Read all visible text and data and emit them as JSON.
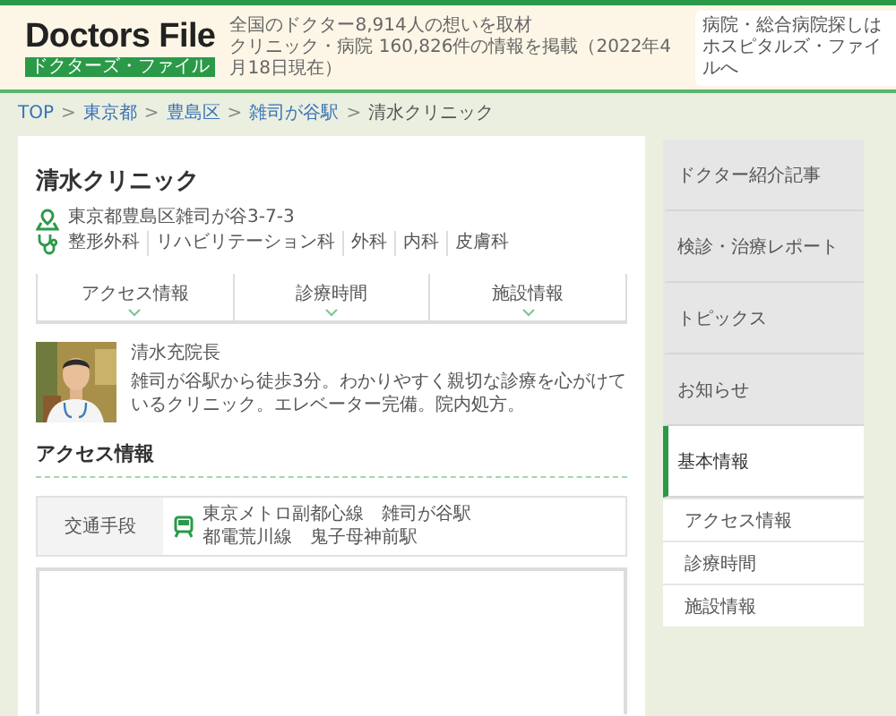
{
  "header": {
    "logo": "Doctors File",
    "logo_sub": "ドクターズ・ファイル",
    "tagline": [
      "全国のドクター8,914人の想いを取材",
      "クリニック・病院 160,826件の情報を掲載（2022年4月18日現在）"
    ],
    "hospital_link": [
      "病院・総合病院探しは",
      "ホスピタルズ・ファイルへ"
    ]
  },
  "breadcrumb": [
    {
      "label": "TOP",
      "separator": ">"
    },
    {
      "label": "東京都",
      "separator": ">"
    },
    {
      "label": "豊島区",
      "separator": ">"
    },
    {
      "label": "雑司が谷駅",
      "separator": ">"
    },
    {
      "label": "清水クリニック"
    }
  ],
  "clinic": {
    "name": "清水クリニック",
    "address": "東京都豊島区雑司が谷3-7-3",
    "departments": [
      "整形外科",
      "リハビリテーション科",
      "外科",
      "内科",
      "皮膚科"
    ]
  },
  "tabs": [
    {
      "label": "アクセス情報"
    },
    {
      "label": "診療時間"
    },
    {
      "label": "施設情報"
    }
  ],
  "doctor": {
    "name": "清水充院長",
    "description": "雑司が谷駅から徒歩3分。わかりやすく親切な診療を心がけているクリニック。エレベーター完備。院内処方。"
  },
  "access": {
    "heading": "アクセス情報",
    "transport_label": "交通手段",
    "lines": [
      "東京メトロ副都心線　雑司が谷駅",
      "都電荒川線　鬼子母神前駅"
    ]
  },
  "sidebar": {
    "items": [
      {
        "label": "ドクター紹介記事",
        "selected": false
      },
      {
        "label": "検診・治療レポート",
        "selected": false
      },
      {
        "label": "トピックス",
        "selected": false
      },
      {
        "label": "お知らせ",
        "selected": false
      },
      {
        "label": "基本情報",
        "selected": true
      }
    ],
    "sub_items": [
      "アクセス情報",
      "診療時間",
      "施設情報"
    ]
  }
}
